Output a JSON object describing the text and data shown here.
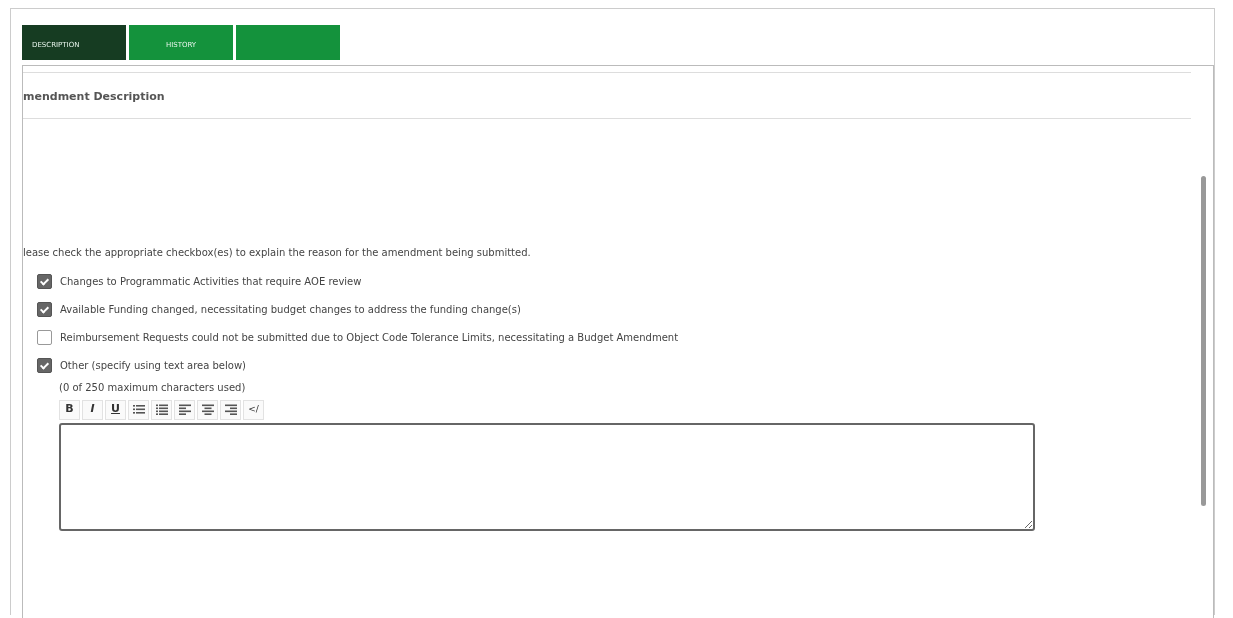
{
  "tabs": [
    {
      "label": "DESCRIPTION",
      "selected": true
    },
    {
      "label": "HISTORY",
      "selected": false
    },
    {
      "selected": false
    }
  ],
  "section": {
    "heading": "mendment Description"
  },
  "instruction": "lease check the appropriate checkbox(es) to explain the reason for the amendment being submitted.",
  "reasons": [
    {
      "label": "Changes to Programmatic Activities that require AOE review",
      "checked": true
    },
    {
      "label": "Available Funding changed, necessitating budget changes to address the funding change(s)",
      "checked": true
    },
    {
      "label": "Reimbursement Requests could not be submitted due to Object Code Tolerance Limits, necessitating a Budget Amendment",
      "checked": false
    },
    {
      "label": "Other (specify using text area below)",
      "checked": true
    }
  ],
  "editor": {
    "counter": "(0 of 250 maximum characters used)",
    "toolbar": [
      {
        "kind": "bold",
        "label": "B"
      },
      {
        "kind": "italic",
        "label": "I"
      },
      {
        "kind": "underline",
        "label": "U"
      },
      {
        "kind": "bullets"
      },
      {
        "kind": "numbers"
      },
      {
        "kind": "align-left"
      },
      {
        "kind": "align-center"
      },
      {
        "kind": "align-right"
      },
      {
        "kind": "code",
        "label": "</"
      }
    ]
  }
}
